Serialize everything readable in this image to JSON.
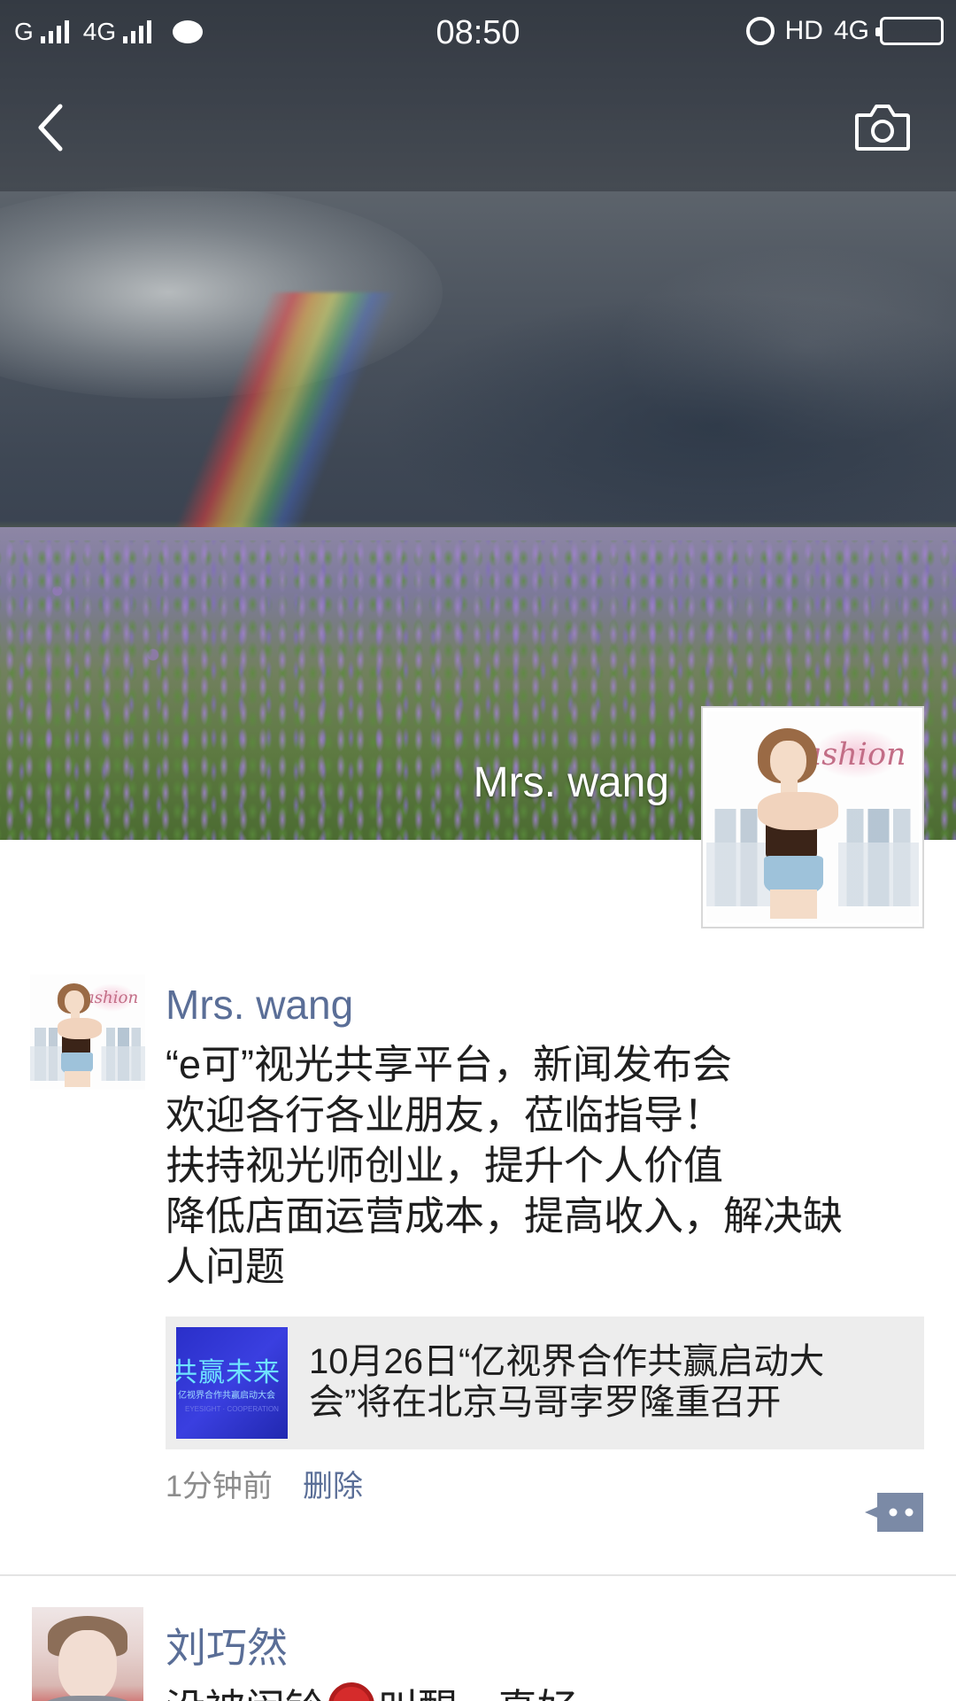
{
  "status_bar": {
    "carrier1": "G",
    "carrier2": "4G",
    "time": "08:50",
    "hd": "HD",
    "network": "4G"
  },
  "nav": {
    "back_icon": "chevron-left-icon",
    "camera_icon": "camera-icon"
  },
  "profile": {
    "name": "Mrs. wang",
    "avatar_text": "Fashion"
  },
  "post": {
    "author": "Mrs. wang",
    "text_lines": [
      "“e可”视光共享平台，新闻发布会",
      "欢迎各行各业朋友，莅临指导！",
      "扶持视光师创业，提升个人价值",
      "降低店面运营成本，提高收入，解决缺",
      "人问题"
    ],
    "share": {
      "thumb_title": "共赢未来",
      "thumb_subtitle": "亿视界合作共赢启动大会",
      "thumb_small": "EYESIGHT · COOPERATION",
      "title_lines": [
        "10月26日“亿视界合作共赢启动大",
        "会”将在北京马哥孛罗隆重召开"
      ]
    },
    "time": "1分钟前",
    "delete_label": "删除",
    "comment_icon": "comment-dots-icon"
  },
  "post2": {
    "author": "刘巧然",
    "text_before": "没被闹铃",
    "text_after": "叫醒，真好"
  },
  "colors": {
    "link_blue": "#5a6e97",
    "card_bg": "#ededed",
    "divider": "#e4e4e4"
  }
}
